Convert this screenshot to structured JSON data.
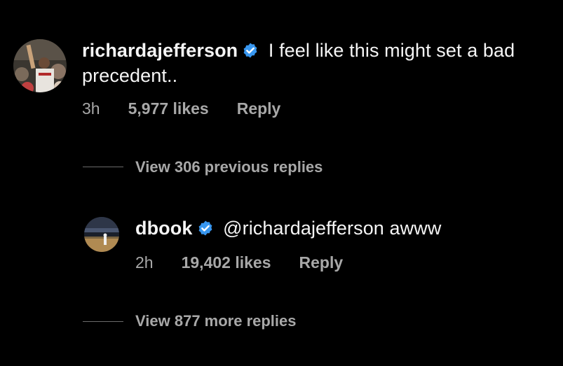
{
  "comment": {
    "username": "richardajefferson",
    "text_line1": " I feel like this might set a bad",
    "text_line2": "precedent..",
    "time": "3h",
    "likes": "5,977 likes",
    "reply_label": "Reply",
    "avatar_icon": "user-avatar-photo"
  },
  "view_previous": {
    "label": "View 306 previous replies"
  },
  "reply": {
    "username": "dbook",
    "text": " @richardajefferson awww",
    "time": "2h",
    "likes": "19,402 likes",
    "reply_label": "Reply",
    "avatar_icon": "user-avatar-photo"
  },
  "view_more": {
    "label": "View 877 more replies"
  },
  "colors": {
    "background": "#000000",
    "text": "#f5f5f5",
    "secondary": "#a8a8a8",
    "verified": "#3897f0"
  },
  "icons": {
    "verified": "verified-badge-icon"
  }
}
